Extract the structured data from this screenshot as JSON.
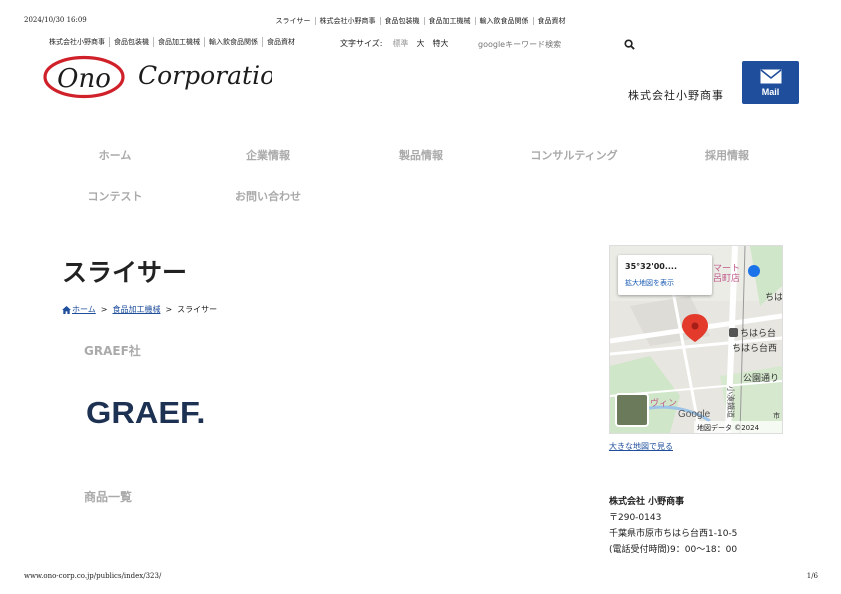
{
  "print": {
    "datetime": "2024/10/30 16:09",
    "url": "www.ono-corp.co.jp/publics/index/323/",
    "page": "1/6",
    "title_parts": [
      "スライサー",
      "株式会社小野商事",
      "食品包装機",
      "食品加工機械",
      "輸入飲食品関係",
      "食品資材"
    ]
  },
  "topnav": {
    "links": [
      "株式会社小野商事",
      "食品包装機",
      "食品加工機械",
      "輸入飲食品関係",
      "食品資材"
    ]
  },
  "fontsize": {
    "label": "文字サイズ:",
    "options": [
      "標準",
      "大",
      "特大"
    ]
  },
  "search": {
    "placeholder": "googleキーワード検索",
    "icon": "search-icon"
  },
  "logo": {
    "mark": "Ono",
    "word": "Corporation",
    "ring_color": "#d0202a"
  },
  "header": {
    "company": "株式会社小野商事",
    "mail_label": "Mail"
  },
  "gnav": {
    "items": [
      "ホーム",
      "企業情報",
      "製品情報",
      "コンサルティング",
      "採用情報",
      "コンテスト",
      "お問い合わせ"
    ]
  },
  "page": {
    "title": "スライサー",
    "breadcrumb": {
      "home": "ホーム",
      "category": "食品加工機械",
      "current": "スライサー",
      "separator": ">"
    },
    "brand_heading": "GRAEF社",
    "brand_logo": "GRAEF.",
    "products_heading": "商品一覧"
  },
  "map": {
    "coord": "35°32'00....",
    "enlarge": "拡大地図を表示",
    "labels": [
      "マート",
      "呂町店",
      "ちは",
      "ちはら台",
      "ちはら台西",
      "公園通り",
      "小湊鐵道",
      "ヴィン",
      "市"
    ],
    "google": "Google",
    "attribution": "地図データ ©2024",
    "bigmap": "大きな地図で見る"
  },
  "contact": {
    "name": "株式会社 小野商事",
    "postal": "〒290-0143",
    "address": "千葉県市原市ちはら台西1-10-5",
    "hours": "(電話受付時間)9：00〜18：00"
  },
  "colors": {
    "accent": "#1f4f9c",
    "nav_text": "#aaaaaa",
    "logo_red": "#d0202a"
  }
}
